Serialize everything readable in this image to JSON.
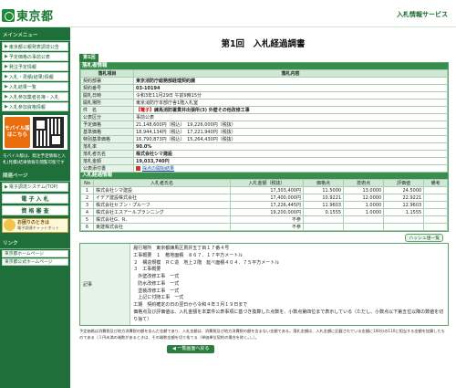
{
  "header": {
    "logo_text": "東京都",
    "service_name": "入札情報サービス"
  },
  "sidebar": {
    "menu_title": "メインメニュー",
    "items": [
      {
        "label": "東京都公報発表調達公告"
      },
      {
        "label": "予定価格の事前公表"
      },
      {
        "label": "発注予定情報"
      },
      {
        "label": "入札・見積(結果)情報"
      },
      {
        "label": "入札結果一覧"
      },
      {
        "label": "入札参加業者名簿・入札"
      },
      {
        "label": "入札参加資格情報"
      }
    ],
    "mobile_label": "モバイル版はこちら",
    "mobile_note": "モバイル版は、発注予定情報と入札(見積)結果情報を閲覧可能です",
    "related_title": "関連ページ",
    "related_items": [
      {
        "label": "電子調達システム(TOP)"
      },
      {
        "label": "電 子 入 札"
      },
      {
        "label": "資 格 審 査"
      }
    ],
    "tool_title": "お困りのときは",
    "tool_sub": "電子調達チャットボット",
    "links_title": "リンク",
    "links": [
      {
        "label": "東京都ホームページ"
      },
      {
        "label": "東京都公式ホームページ"
      }
    ]
  },
  "main": {
    "page_title": "第1回　入札経過調書",
    "tab_label": "第1回",
    "info_section_title": "落札者情報",
    "info_headers": {
      "item": "落札項目",
      "content": "落札内容"
    },
    "info_rows": [
      {
        "label": "契約部署",
        "value": "東京消防庁総務部経理契約課",
        "bold": true
      },
      {
        "label": "契約番号",
        "value": "03-10194",
        "bold": true
      },
      {
        "label": "開札日時",
        "value": "令和3年11月29日 午前9時15分",
        "bold": false
      },
      {
        "label": "開札場所",
        "value": "東京消防庁本部庁舎1階入札室",
        "bold": false
      },
      {
        "label": "件　名",
        "tag": "【電子】",
        "value": "練馬消防署貫井出張所(3) 外壁その他改修工事",
        "bold": true
      },
      {
        "label": "公表区分",
        "value": "事前公表",
        "bold": false
      },
      {
        "label": "予定価格",
        "value": "21,148,600円（税込）　19,226,000円（税抜）",
        "bold": false
      },
      {
        "label": "基準価格",
        "value": "18,944,134円（税込）　17,221,940円（税抜）",
        "bold": false
      },
      {
        "label": "特別基準価格",
        "value": "16,790,873円（税込）　15,264,430円（税抜）",
        "bold": false
      },
      {
        "label": "落札率",
        "value": "90.0%",
        "bold": true
      },
      {
        "label": "落札者氏名",
        "value": "株式会社シマ建設",
        "bold": true
      },
      {
        "label": "落札金額",
        "value": "19,033,740円",
        "bold": true
      },
      {
        "label": "公表添付書",
        "link": "採点の開始結果",
        "bold": false
      }
    ],
    "bids_section_title": "入札経過情報",
    "bids_headers": {
      "no": "No",
      "name": "入札者氏名",
      "amount": "入札金額（税抜）",
      "price_pt": "価格点",
      "tech_pt": "技術点",
      "eval": "評価値",
      "note": "備考"
    },
    "bids": [
      {
        "no": "1",
        "name": "株式会社シマ建設",
        "amount": "17,303,400円",
        "price": "11.5000",
        "tech": "13.0000",
        "eval": "24.5000",
        "note": ""
      },
      {
        "no": "2",
        "name": "イデア建設株式会社",
        "amount": "17,400,000円",
        "price": "10.9221",
        "tech": "12.0000",
        "eval": "22.9221",
        "note": ""
      },
      {
        "no": "3",
        "name": "株式会社セブン・プルーフ",
        "amount": "17,226,445円",
        "price": "11.9603",
        "tech": "1.0000",
        "eval": "12.9603",
        "note": ""
      },
      {
        "no": "4",
        "name": "株式会社エスアールプランニング",
        "amount": "19,200,000円",
        "price": "0.1555",
        "tech": "1.0000",
        "eval": "1.1555",
        "note": ""
      },
      {
        "no": "5",
        "name": "株式会社G．R．",
        "amount": "不参",
        "price": "",
        "tech": "",
        "eval": "",
        "note": ""
      },
      {
        "no": "6",
        "name": "東建株式会社",
        "amount": "不参",
        "price": "",
        "tech": "",
        "eval": "",
        "note": ""
      }
    ],
    "hoki_label": "ハッシュ値一覧",
    "remarks_label": "記事",
    "remarks_text": "履行場所　東京都練馬区貫井五丁目１７番４号\n工事概要　１　敷地面積　８６７．１７平方メートル\n２　構造規模　ＲＣ造　地上２階　延べ面積４０４．７５平方メートル\n３　工事概要\n　外壁改修工事　一式\n　防水改修工事　一式\n　塗装改修工事　一式\n　上記に付随工事　一式\n工期　契約確定の日の翌日から令和４年３月１９日まで\n価格点及び評価値は、入札金額を本案件公表事項に基づき換算した点数を、小数点第四位まで表示している（ただし、小数点以下第五位以降の数値を切り捨て）",
    "footnote": "予定価格は消費税及び地方消費税の額を含んだ金額であり、入札金額は、消費税及び地方消費税の額を含まない金額である。落札金額は、入札金額に記載されている金額に100分の110に相当する金額を加算したものである（１円未満の端数があるときは、その端数金額を切り捨てる（単価単位契約の場合を除く。）。）。",
    "back_button": "◀ 一覧画面へ戻る"
  }
}
